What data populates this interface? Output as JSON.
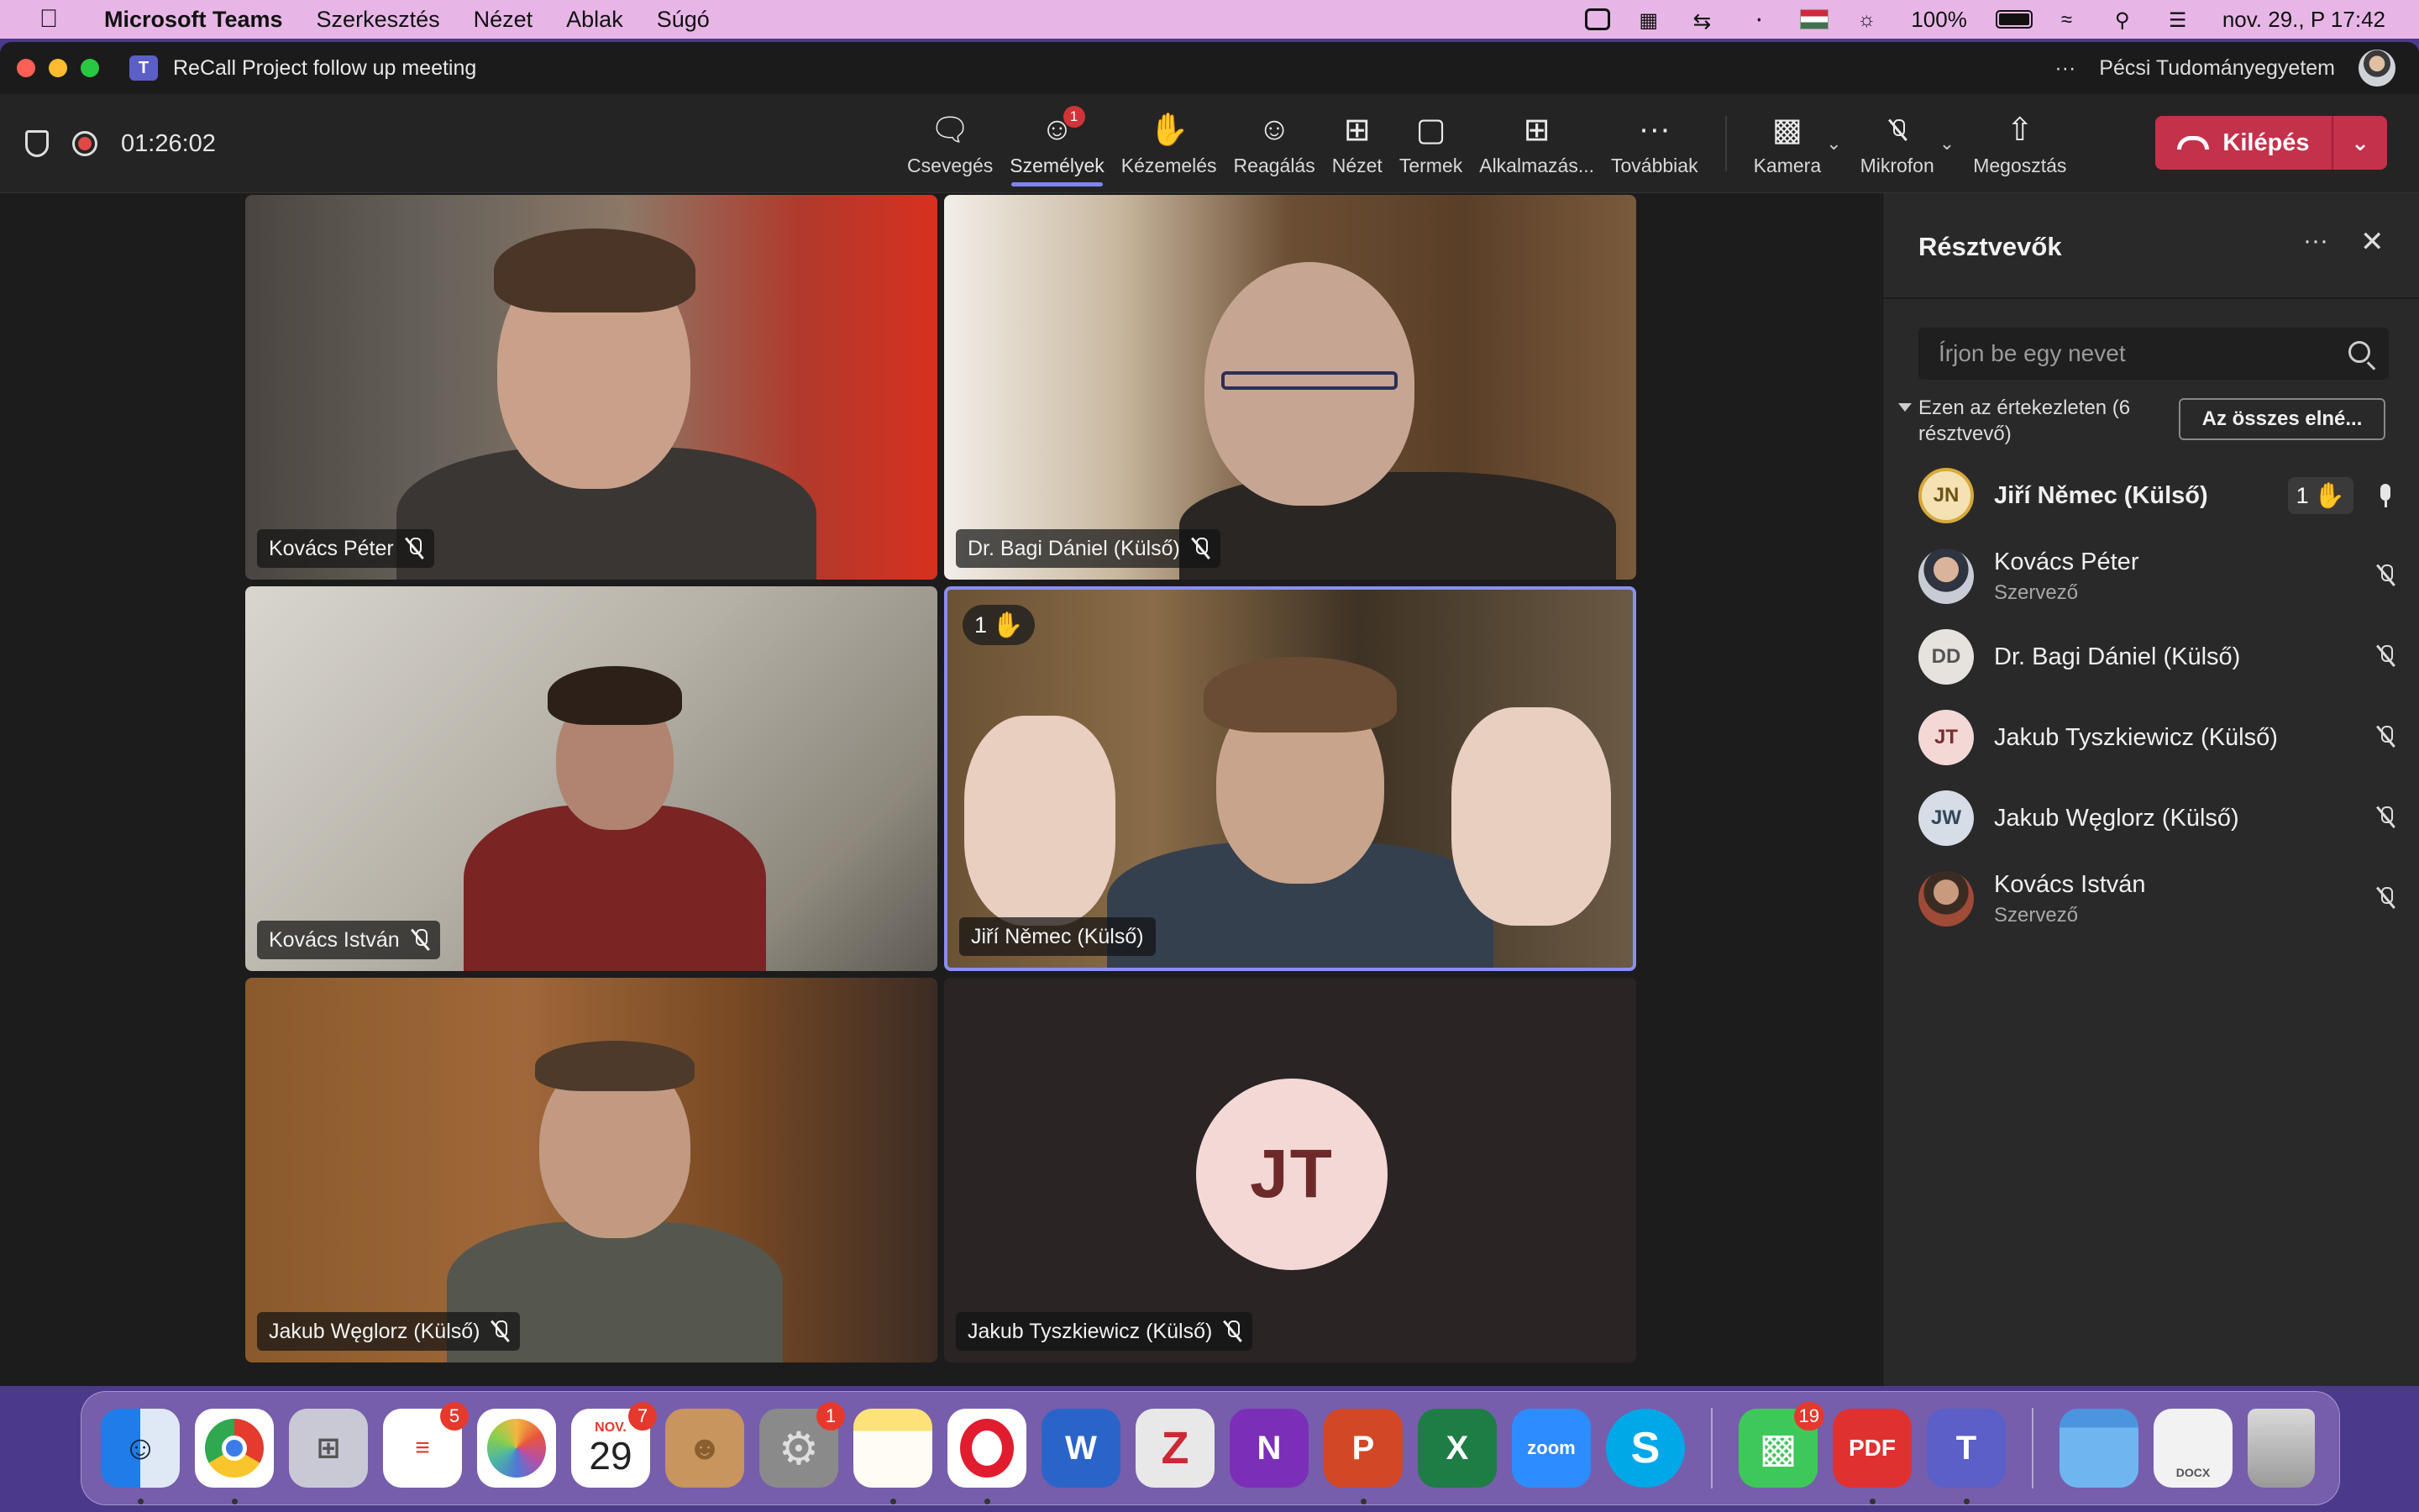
{
  "menubar": {
    "app": "Microsoft Teams",
    "items": [
      "Szerkesztés",
      "Nézet",
      "Ablak",
      "Súgó"
    ],
    "battery": "100%",
    "datetime": "nov. 29., P  17:42"
  },
  "window": {
    "title": "ReCall Project follow up meeting",
    "org": "Pécsi Tudományegyetem",
    "more": "···"
  },
  "toolbar": {
    "timer": "01:26:02",
    "tools": [
      {
        "label": "Csevegés",
        "icon": "chat-icon"
      },
      {
        "label": "Személyek",
        "icon": "people-icon",
        "badge": "1",
        "active": true
      },
      {
        "label": "Kézemelés",
        "icon": "raise-hand-icon"
      },
      {
        "label": "Reagálás",
        "icon": "react-icon"
      },
      {
        "label": "Nézet",
        "icon": "view-icon"
      },
      {
        "label": "Termek",
        "icon": "rooms-icon"
      },
      {
        "label": "Alkalmazás...",
        "icon": "apps-icon"
      },
      {
        "label": "Továbbiak",
        "icon": "more-icon"
      }
    ],
    "camera": "Kamera",
    "mic": "Mikrofon",
    "share": "Megosztás",
    "leave": "Kilépés"
  },
  "tiles": [
    {
      "name": "Kovács Péter"
    },
    {
      "name": "Dr. Bagi Dániel (Külső)"
    },
    {
      "name": "Kovács István"
    },
    {
      "name": "Jiří Němec (Külső)",
      "raised": "1"
    },
    {
      "name": "Jakub Węglorz (Külső)"
    },
    {
      "name": "Jakub Tyszkiewicz (Külső)",
      "initials": "JT"
    }
  ],
  "panel": {
    "title": "Résztvevők",
    "search_placeholder": "Írjon be egy nevet",
    "section": "Ezen az értekezleten (6 résztvevő)",
    "admit_all": "Az összes elné...",
    "participants": [
      {
        "initials": "JN",
        "name": "Jiří Němec (Külső)",
        "raised": "1",
        "mic": "on"
      },
      {
        "initials": "",
        "name": "Kovács Péter",
        "role": "Szervező",
        "mic": "muted"
      },
      {
        "initials": "DD",
        "name": "Dr. Bagi Dániel (Külső)",
        "mic": "muted"
      },
      {
        "initials": "JT",
        "name": "Jakub Tyszkiewicz (Külső)",
        "mic": "muted"
      },
      {
        "initials": "JW",
        "name": "Jakub Węglorz (Külső)",
        "mic": "muted"
      },
      {
        "initials": "",
        "name": "Kovács István",
        "role": "Szervező",
        "mic": "muted"
      }
    ]
  },
  "dock": {
    "apps": [
      {
        "name": "Finder",
        "color": "#3c9cf0"
      },
      {
        "name": "Chrome",
        "color": "#f1f1f1"
      },
      {
        "name": "Launchpad",
        "color": "#c9c9d6"
      },
      {
        "name": "Reminders",
        "color": "#ffffff",
        "badge": "5"
      },
      {
        "name": "Photos",
        "color": "#ffffff"
      },
      {
        "name": "Calendar",
        "color": "#ffffff",
        "badge": "7",
        "month": "NOV.",
        "day": "29"
      },
      {
        "name": "Contacts",
        "color": "#c7955d"
      },
      {
        "name": "System Settings",
        "color": "#8a8a8a",
        "badge": "1"
      },
      {
        "name": "Notes",
        "color": "#fde27a"
      },
      {
        "name": "Opera",
        "color": "#ffffff"
      },
      {
        "name": "Word",
        "color": "#2b64c8",
        "label": "W"
      },
      {
        "name": "Zotero",
        "color": "#e8e8e8",
        "label": "Z"
      },
      {
        "name": "OneNote",
        "color": "#7b2fb8",
        "label": "N"
      },
      {
        "name": "PowerPoint",
        "color": "#d24726",
        "label": "P"
      },
      {
        "name": "Excel",
        "color": "#1e7d45",
        "label": "X"
      },
      {
        "name": "Zoom",
        "color": "#2d8cff",
        "label": "zoom"
      },
      {
        "name": "Skype",
        "color": "#00a8e8",
        "label": "S"
      },
      {
        "name": "FaceTime",
        "color": "#3fc85a",
        "badge": "19"
      },
      {
        "name": "PDF Expert",
        "color": "#e03131",
        "label": "PDF"
      },
      {
        "name": "Teams",
        "color": "#5b5fc7",
        "label": "T"
      },
      {
        "name": "Folder",
        "color": "#5fa8e8"
      },
      {
        "name": "Document",
        "color": "#f2f2f2",
        "label": "DOCX"
      },
      {
        "name": "Trash",
        "color": "#b5b5b5"
      }
    ]
  }
}
